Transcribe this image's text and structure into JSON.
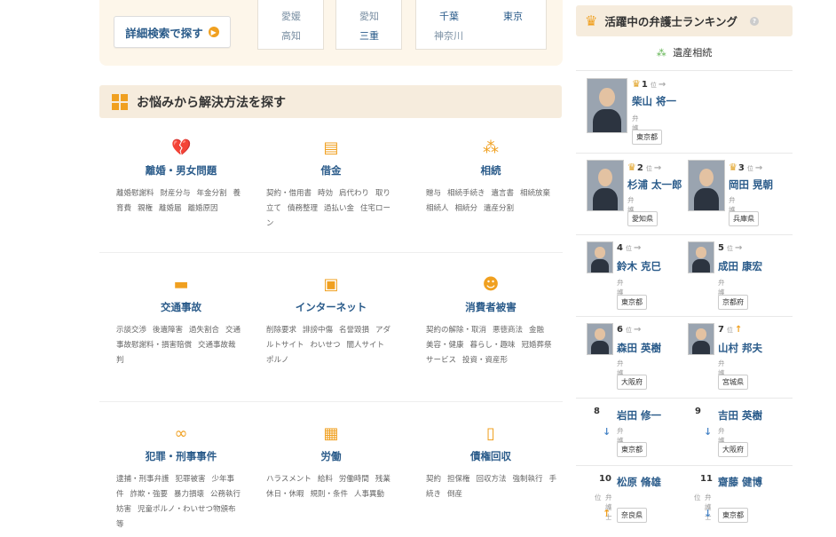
{
  "search": {
    "detail_button": "詳細検索で探す",
    "prefs_box1": [
      "愛媛",
      "高知"
    ],
    "prefs_box2": [
      "愛知",
      "三重"
    ],
    "prefs_box3": [
      "千葉",
      "東京",
      "神奈川"
    ]
  },
  "section": {
    "title": "お悩みから解決方法を探す"
  },
  "categories": [
    {
      "title": "離婚・男女問題",
      "icon": "broken-heart-icon",
      "links": [
        "離婚慰謝料",
        "財産分与",
        "年金分割",
        "養育費",
        "親権",
        "離婚届",
        "離婚原因"
      ]
    },
    {
      "title": "借金",
      "icon": "coins-icon",
      "links": [
        "契約・借用書",
        "時効",
        "肩代わり",
        "取り立て",
        "債務整理",
        "過払い金",
        "住宅ローン"
      ]
    },
    {
      "title": "相続",
      "icon": "family-tree-icon",
      "links": [
        "贈与",
        "相続手続き",
        "遺言書",
        "相続放棄",
        "相続人",
        "相続分",
        "遺産分割"
      ]
    },
    {
      "title": "交通事故",
      "icon": "truck-icon",
      "links": [
        "示談交渉",
        "後遺障害",
        "過失割合",
        "交通事故慰謝料・損害賠償",
        "交通事故裁判"
      ]
    },
    {
      "title": "インターネット",
      "icon": "monitor-icon",
      "links": [
        "削除要求",
        "誹謗中傷",
        "名誉毀損",
        "アダルトサイト",
        "わいせつ",
        "闇人サイト",
        "ポルノ"
      ]
    },
    {
      "title": "消費者被害",
      "icon": "person-icon",
      "links": [
        "契約の解除・取消",
        "悪徳商法",
        "金融",
        "美容・健康",
        "暮らし・趣味",
        "冠婚葬祭サービス",
        "投資・資産形"
      ]
    },
    {
      "title": "犯罪・刑事事件",
      "icon": "handcuffs-icon",
      "links": [
        "逮捕・刑事弁護",
        "犯罪被害",
        "少年事件",
        "詐欺・強要",
        "暴力損壊",
        "公務執行妨害",
        "児童ポルノ・わいせつ物頒布等"
      ]
    },
    {
      "title": "労働",
      "icon": "toolbox-icon",
      "links": [
        "ハラスメント",
        "給料",
        "労働時間",
        "残業",
        "休日・休暇",
        "規則・条件",
        "人事異動"
      ]
    },
    {
      "title": "債権回収",
      "icon": "money-phone-icon",
      "links": [
        "契約",
        "担保権",
        "回収方法",
        "強制執行",
        "手続き",
        "倒産"
      ]
    }
  ],
  "ranking": {
    "title": "活躍中の弁護士ランキング",
    "help": "?",
    "subtitle": "遺産相続",
    "unit": "位",
    "lawyer_title": "弁護士",
    "lawyers": [
      {
        "rank": "1",
        "name": "柴山 将一",
        "pref": "東京都"
      },
      {
        "rank": "2",
        "name": "杉浦 太一郎",
        "pref": "愛知県"
      },
      {
        "rank": "3",
        "name": "岡田 晃朝",
        "pref": "兵庫県"
      },
      {
        "rank": "4",
        "name": "鈴木 克巳",
        "pref": "東京都"
      },
      {
        "rank": "5",
        "name": "成田 康宏",
        "pref": "京都府"
      },
      {
        "rank": "6",
        "name": "森田 英樹",
        "pref": "大阪府"
      },
      {
        "rank": "7",
        "name": "山村 邦夫",
        "pref": "宮城県"
      },
      {
        "rank": "8",
        "name": "岩田 修一",
        "pref": "東京都"
      },
      {
        "rank": "9",
        "name": "吉田 英樹",
        "pref": "大阪府"
      },
      {
        "rank": "10",
        "name": "松原 脩雄",
        "pref": "奈良県"
      },
      {
        "rank": "11",
        "name": "齋藤 健博",
        "pref": "東京都"
      }
    ]
  },
  "colors": {
    "accent": "#f0a020",
    "link": "#2a5b8a",
    "header_bg": "#f6ecdd",
    "band_bg": "#fdf6ea"
  }
}
